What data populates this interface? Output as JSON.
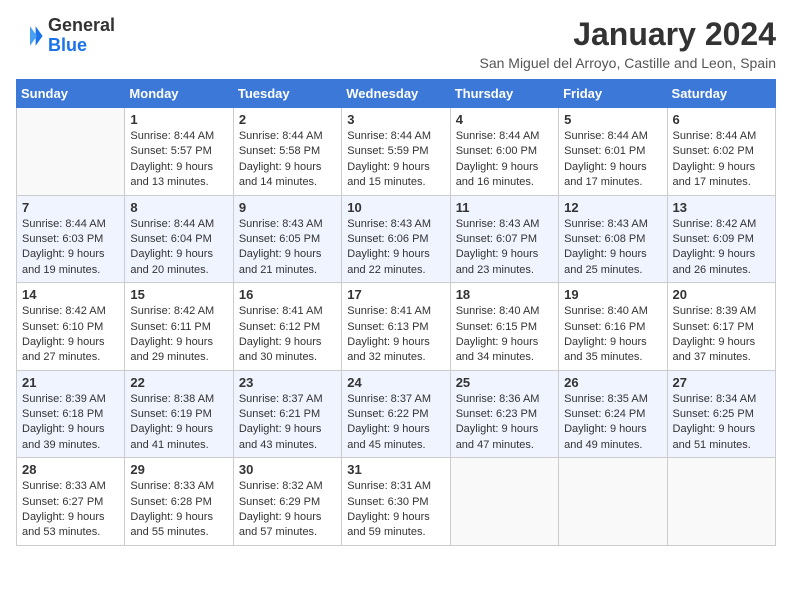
{
  "logo": {
    "line1": "General",
    "line2": "Blue"
  },
  "title": "January 2024",
  "subtitle": "San Miguel del Arroyo, Castille and Leon, Spain",
  "days": [
    "Sunday",
    "Monday",
    "Tuesday",
    "Wednesday",
    "Thursday",
    "Friday",
    "Saturday"
  ],
  "weeks": [
    [
      {
        "num": "",
        "text": ""
      },
      {
        "num": "1",
        "text": "Sunrise: 8:44 AM\nSunset: 5:57 PM\nDaylight: 9 hours\nand 13 minutes."
      },
      {
        "num": "2",
        "text": "Sunrise: 8:44 AM\nSunset: 5:58 PM\nDaylight: 9 hours\nand 14 minutes."
      },
      {
        "num": "3",
        "text": "Sunrise: 8:44 AM\nSunset: 5:59 PM\nDaylight: 9 hours\nand 15 minutes."
      },
      {
        "num": "4",
        "text": "Sunrise: 8:44 AM\nSunset: 6:00 PM\nDaylight: 9 hours\nand 16 minutes."
      },
      {
        "num": "5",
        "text": "Sunrise: 8:44 AM\nSunset: 6:01 PM\nDaylight: 9 hours\nand 17 minutes."
      },
      {
        "num": "6",
        "text": "Sunrise: 8:44 AM\nSunset: 6:02 PM\nDaylight: 9 hours\nand 17 minutes."
      }
    ],
    [
      {
        "num": "7",
        "text": "Sunrise: 8:44 AM\nSunset: 6:03 PM\nDaylight: 9 hours\nand 19 minutes."
      },
      {
        "num": "8",
        "text": "Sunrise: 8:44 AM\nSunset: 6:04 PM\nDaylight: 9 hours\nand 20 minutes."
      },
      {
        "num": "9",
        "text": "Sunrise: 8:43 AM\nSunset: 6:05 PM\nDaylight: 9 hours\nand 21 minutes."
      },
      {
        "num": "10",
        "text": "Sunrise: 8:43 AM\nSunset: 6:06 PM\nDaylight: 9 hours\nand 22 minutes."
      },
      {
        "num": "11",
        "text": "Sunrise: 8:43 AM\nSunset: 6:07 PM\nDaylight: 9 hours\nand 23 minutes."
      },
      {
        "num": "12",
        "text": "Sunrise: 8:43 AM\nSunset: 6:08 PM\nDaylight: 9 hours\nand 25 minutes."
      },
      {
        "num": "13",
        "text": "Sunrise: 8:42 AM\nSunset: 6:09 PM\nDaylight: 9 hours\nand 26 minutes."
      }
    ],
    [
      {
        "num": "14",
        "text": "Sunrise: 8:42 AM\nSunset: 6:10 PM\nDaylight: 9 hours\nand 27 minutes."
      },
      {
        "num": "15",
        "text": "Sunrise: 8:42 AM\nSunset: 6:11 PM\nDaylight: 9 hours\nand 29 minutes."
      },
      {
        "num": "16",
        "text": "Sunrise: 8:41 AM\nSunset: 6:12 PM\nDaylight: 9 hours\nand 30 minutes."
      },
      {
        "num": "17",
        "text": "Sunrise: 8:41 AM\nSunset: 6:13 PM\nDaylight: 9 hours\nand 32 minutes."
      },
      {
        "num": "18",
        "text": "Sunrise: 8:40 AM\nSunset: 6:15 PM\nDaylight: 9 hours\nand 34 minutes."
      },
      {
        "num": "19",
        "text": "Sunrise: 8:40 AM\nSunset: 6:16 PM\nDaylight: 9 hours\nand 35 minutes."
      },
      {
        "num": "20",
        "text": "Sunrise: 8:39 AM\nSunset: 6:17 PM\nDaylight: 9 hours\nand 37 minutes."
      }
    ],
    [
      {
        "num": "21",
        "text": "Sunrise: 8:39 AM\nSunset: 6:18 PM\nDaylight: 9 hours\nand 39 minutes."
      },
      {
        "num": "22",
        "text": "Sunrise: 8:38 AM\nSunset: 6:19 PM\nDaylight: 9 hours\nand 41 minutes."
      },
      {
        "num": "23",
        "text": "Sunrise: 8:37 AM\nSunset: 6:21 PM\nDaylight: 9 hours\nand 43 minutes."
      },
      {
        "num": "24",
        "text": "Sunrise: 8:37 AM\nSunset: 6:22 PM\nDaylight: 9 hours\nand 45 minutes."
      },
      {
        "num": "25",
        "text": "Sunrise: 8:36 AM\nSunset: 6:23 PM\nDaylight: 9 hours\nand 47 minutes."
      },
      {
        "num": "26",
        "text": "Sunrise: 8:35 AM\nSunset: 6:24 PM\nDaylight: 9 hours\nand 49 minutes."
      },
      {
        "num": "27",
        "text": "Sunrise: 8:34 AM\nSunset: 6:25 PM\nDaylight: 9 hours\nand 51 minutes."
      }
    ],
    [
      {
        "num": "28",
        "text": "Sunrise: 8:33 AM\nSunset: 6:27 PM\nDaylight: 9 hours\nand 53 minutes."
      },
      {
        "num": "29",
        "text": "Sunrise: 8:33 AM\nSunset: 6:28 PM\nDaylight: 9 hours\nand 55 minutes."
      },
      {
        "num": "30",
        "text": "Sunrise: 8:32 AM\nSunset: 6:29 PM\nDaylight: 9 hours\nand 57 minutes."
      },
      {
        "num": "31",
        "text": "Sunrise: 8:31 AM\nSunset: 6:30 PM\nDaylight: 9 hours\nand 59 minutes."
      },
      {
        "num": "",
        "text": ""
      },
      {
        "num": "",
        "text": ""
      },
      {
        "num": "",
        "text": ""
      }
    ]
  ]
}
